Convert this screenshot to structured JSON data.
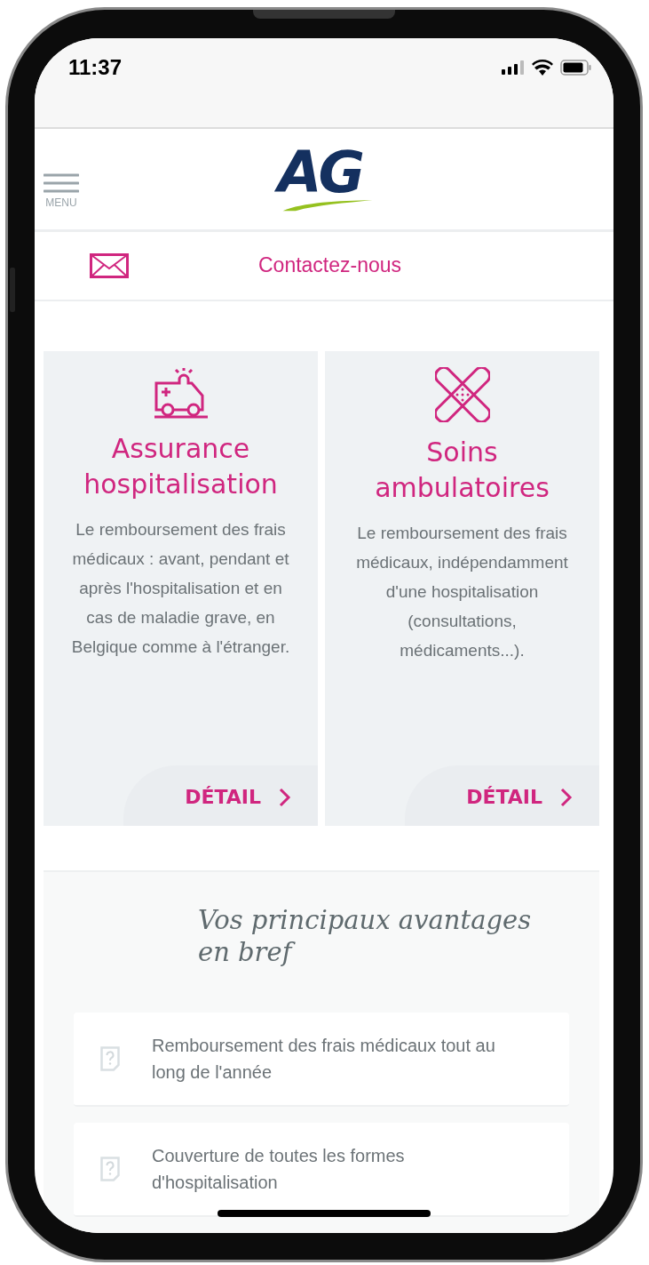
{
  "status_bar": {
    "time": "11:37"
  },
  "header": {
    "menu_label": "MENU",
    "logo": "AG"
  },
  "contact": {
    "label": "Contactez-nous"
  },
  "cards": [
    {
      "kind": "ambulance",
      "title": "Assurance hospitalisation",
      "description": "Le remboursement des frais médicaux : avant, pendant et après l'hospitalisation et en cas de maladie grave, en Belgique comme à l'étranger.",
      "link": "DÉTAIL"
    },
    {
      "kind": "bandage",
      "title": "Soins ambulatoires",
      "description": "Le remboursement des frais médicaux, indépendamment d'une hospitalisation (consultations, médicaments...).",
      "link": "DÉTAIL"
    }
  ],
  "advantages": {
    "title": "Vos principaux avantages en bref",
    "items": [
      {
        "text": "Remboursement des frais médicaux tout au long de l'année"
      },
      {
        "text": "Couverture de toutes les formes d'hospitalisation"
      }
    ]
  }
}
